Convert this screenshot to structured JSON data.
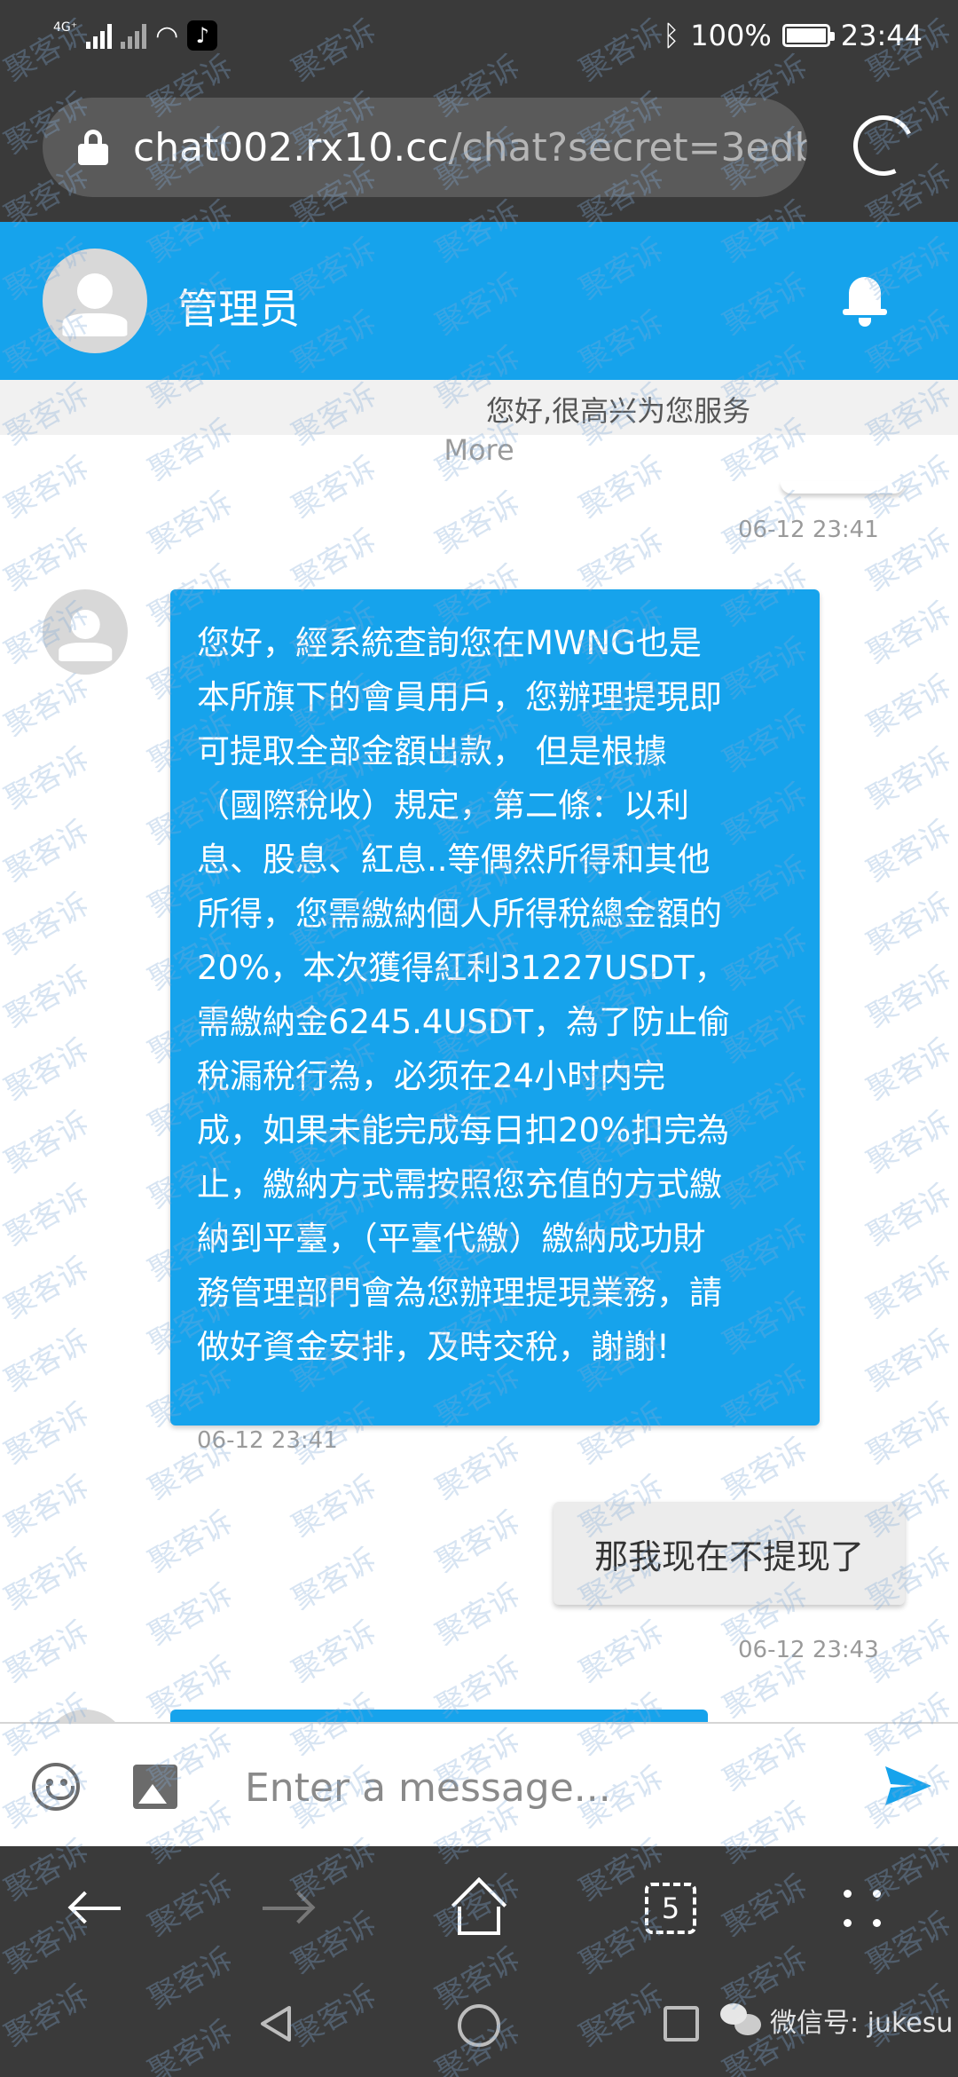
{
  "status_bar": {
    "network": "4G⁺",
    "battery": "100%",
    "battery_level": 1.0,
    "time": "23:44"
  },
  "browser": {
    "url_host": "chat002.rx10.cc",
    "url_rest": "/chat?secret=3edb",
    "tab_count": "5"
  },
  "chat_header": {
    "agent_name": "管理员"
  },
  "messages": {
    "greeting": "您好,很高兴为您服务",
    "more_label": "More",
    "ts1": "06-12 23:41",
    "incoming_lines": [
      "您好，經系統查詢您在MWNG也是",
      "本所旗下的會員用戶，您辦理提現即",
      "可提取全部金額出款， 但是根據",
      "（國際稅收）規定，第二條：以利",
      "息、股息、紅息..等偶然所得和其他",
      "所得，您需繳納個人所得稅總金額的",
      "20%，本次獲得紅利31227USDT，",
      "需繳納金6245.4USDT，為了防止偷",
      "稅漏稅行為，必须在24小时内完",
      "成，如果未能完成每日扣20%扣完為",
      "止，繳納方式需按照您充值的方式繳",
      "納到平臺，（平臺代繳）繳納成功財",
      "務管理部門會為您辦理提現業務，請",
      "做好資金安排，及時交稅，謝謝!"
    ],
    "ts2": "06-12 23:41",
    "outgoing": "那我现在不提现了",
    "ts3": "06-12 23:43"
  },
  "composer": {
    "placeholder": "Enter a message..."
  },
  "watermark_text": "聚客诉",
  "wechat_label": "微信号: jukesu",
  "colors": {
    "accent": "#16a3ec",
    "dark_bar": "#3a3a3a"
  }
}
